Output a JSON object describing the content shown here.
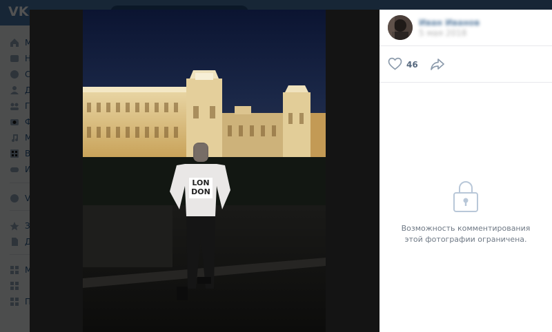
{
  "app": {
    "logo_text": "VK"
  },
  "sidebar": {
    "items": [
      {
        "label": "М",
        "icon": "home-icon"
      },
      {
        "label": "Н",
        "icon": "news-icon"
      },
      {
        "label": "С",
        "icon": "messages-icon"
      },
      {
        "label": "Д",
        "icon": "friends-icon"
      },
      {
        "label": "Г",
        "icon": "communities-icon"
      },
      {
        "label": "Ф",
        "icon": "photos-icon"
      },
      {
        "label": "М",
        "icon": "music-icon"
      },
      {
        "label": "В",
        "icon": "video-icon"
      },
      {
        "label": "И",
        "icon": "games-icon"
      },
      {
        "label": "V",
        "icon": "vk-pay-icon"
      },
      {
        "label": "З",
        "icon": "bookmarks-icon"
      },
      {
        "label": "Д",
        "icon": "documents-icon"
      },
      {
        "label": "М",
        "icon": "apps-icon"
      },
      {
        "label": "",
        "icon": "apps-icon"
      },
      {
        "label": "П",
        "icon": "apps-icon"
      }
    ]
  },
  "viewer": {
    "author": {
      "name": "Иван Иванов",
      "date": "5 мая 2018"
    },
    "likes": {
      "count": "46"
    },
    "comments": {
      "restricted_text": "Возможность комментирования этой фотографии ограничена."
    },
    "photo": {
      "subject": "man at night in front of illuminated palace",
      "shirt_text": [
        "LON",
        "DON"
      ]
    }
  },
  "colors": {
    "header": "#4a76a8",
    "link": "#2a5885",
    "muted_text": "#6f7985",
    "icon": "#8fa1b4"
  }
}
